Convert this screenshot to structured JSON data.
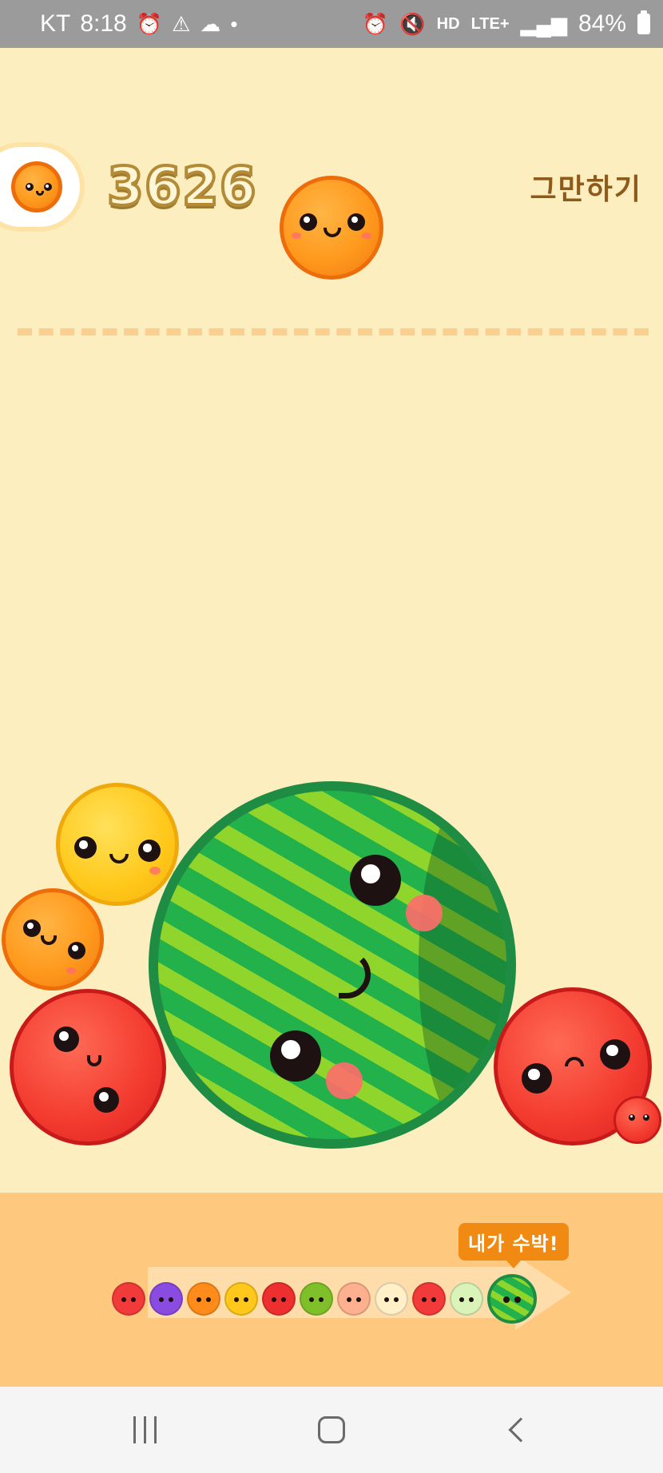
{
  "status_bar": {
    "carrier": "KT",
    "time": "8:18",
    "left_icons": [
      "alarm-icon",
      "warning-icon",
      "cloud-icon",
      "dot-icon"
    ],
    "right_icons": [
      "alarm-icon",
      "mute-icon",
      "hd-icon",
      "lte-icon",
      "signal-icon"
    ],
    "hd_label": "HD",
    "network": "LTE+",
    "battery": "84%"
  },
  "game": {
    "score": "3626",
    "quit_label": "그만하기",
    "next_fruit": "orange",
    "current_fruit": "orange",
    "fruits_on_board": [
      "yellow",
      "orange",
      "red",
      "watermelon",
      "red",
      "strawberry"
    ]
  },
  "evolution": {
    "badge": "내가 수박!",
    "items": [
      {
        "name": "cherry",
        "color": "#f33a3a"
      },
      {
        "name": "grape",
        "color": "#8a4be0"
      },
      {
        "name": "tangerine",
        "color": "#ff8c1a"
      },
      {
        "name": "lemon",
        "color": "#ffc81a"
      },
      {
        "name": "apple",
        "color": "#ee2f2f"
      },
      {
        "name": "kiwi",
        "color": "#7fc02a"
      },
      {
        "name": "peach",
        "color": "#ffb08f"
      },
      {
        "name": "pineapple",
        "color": "#fff0c8"
      },
      {
        "name": "tomato",
        "color": "#f33a3a"
      },
      {
        "name": "melon",
        "color": "#d9f3b8"
      },
      {
        "name": "watermelon",
        "color": "#23b14c"
      }
    ]
  },
  "nav_bar": {
    "buttons": [
      "recents-icon",
      "home-icon",
      "back-icon"
    ]
  },
  "colors": {
    "background": "#fdeec0",
    "panel": "#fec97f",
    "score_outline": "#b38a36",
    "quit_text": "#8e5a1a",
    "badge": "#f18a12"
  }
}
